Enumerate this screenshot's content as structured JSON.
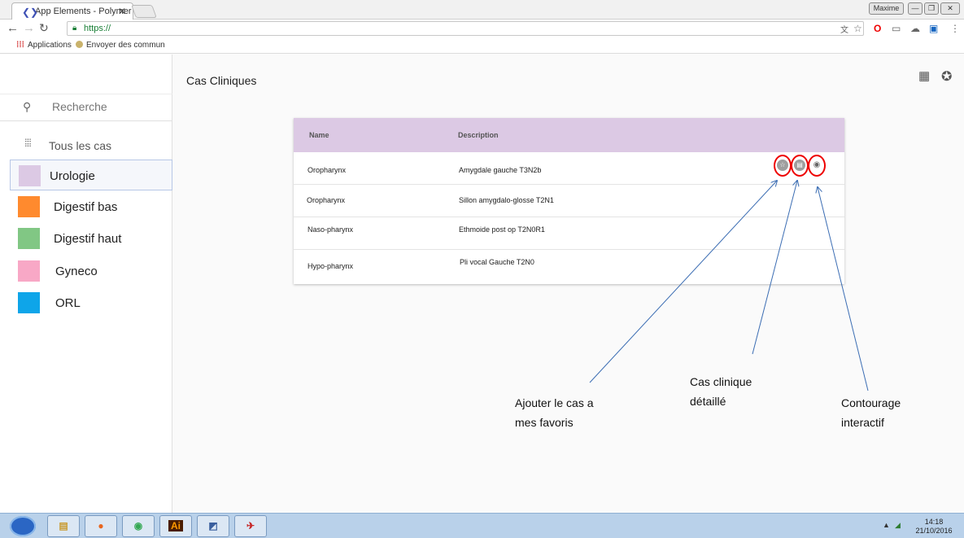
{
  "browser": {
    "tab_title": "App Elements - Polymer",
    "tab_close": "✕",
    "user": "Maxime",
    "url": "https://",
    "bookmarks": [
      "Applications",
      "Envoyer des commun"
    ]
  },
  "sidebar": {
    "search_placeholder": "Recherche",
    "all_cases_label": "Tous les cas",
    "categories": [
      {
        "label": "Urologie",
        "color": "#dcc9e4"
      },
      {
        "label": "Digestif  bas",
        "color": "#ff8a2e"
      },
      {
        "label": "Digestif haut",
        "color": "#81c784"
      },
      {
        "label": "Gyneco",
        "color": "#f8a8c6"
      },
      {
        "label": "ORL",
        "color": "#0ea5e9"
      }
    ]
  },
  "main": {
    "title": "Cas Cliniques",
    "table": {
      "columns": [
        "Name",
        "Description"
      ],
      "rows": [
        {
          "name": "Oropharynx",
          "description": "Amygdale gauche T3N2b"
        },
        {
          "name": "Oropharynx",
          "description": "Sillon amygdalo-glosse T2N1"
        },
        {
          "name": "Naso-pharynx",
          "description": "Ethmoide post op T2N0R1"
        },
        {
          "name": "Hypo-pharynx",
          "description": "Pli vocal Gauche T2N0"
        }
      ]
    }
  },
  "annotations": {
    "favorites": [
      "Ajouter le cas a",
      "mes favoris"
    ],
    "detailed": [
      "Cas clinique",
      "détaillé"
    ],
    "contouring": [
      "Contourage",
      "interactif"
    ]
  },
  "taskbar": {
    "app_labels": [
      "Ai"
    ],
    "time": "14:18",
    "date": "21/10/2016"
  },
  "colors": {
    "table_header": "#dcc9e4",
    "highlight_ring": "#e00000"
  }
}
